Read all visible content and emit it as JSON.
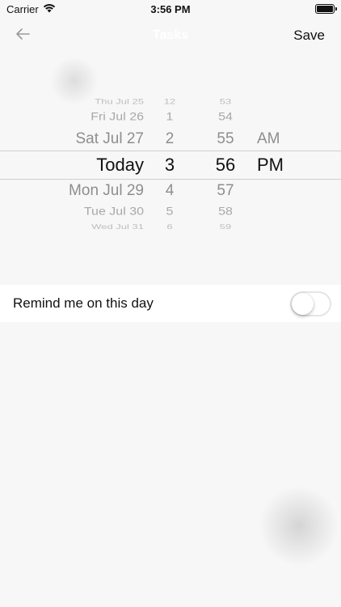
{
  "status_bar": {
    "carrier": "Carrier",
    "time": "3:56 PM"
  },
  "nav": {
    "title": "Tasks",
    "save_label": "Save"
  },
  "picker": {
    "dates": [
      "Thu Jul 25",
      "Fri Jul 26",
      "Sat Jul 27",
      "Today",
      "Mon Jul 29",
      "Tue Jul 30",
      "Wed Jul 31"
    ],
    "hours": [
      "12",
      "1",
      "2",
      "3",
      "4",
      "5",
      "6"
    ],
    "minutes": [
      "53",
      "54",
      "55",
      "56",
      "57",
      "58",
      "59"
    ],
    "ampm": [
      "AM",
      "PM"
    ],
    "selected": {
      "date": "Today",
      "hour": "3",
      "minute": "56",
      "ampm": "PM"
    }
  },
  "reminder": {
    "label": "Remind me on this day",
    "enabled": false
  },
  "colors": {
    "background": "#f7f7f7",
    "row_background": "#ffffff",
    "text": "#111111",
    "muted_text": "#9a9a9a"
  }
}
